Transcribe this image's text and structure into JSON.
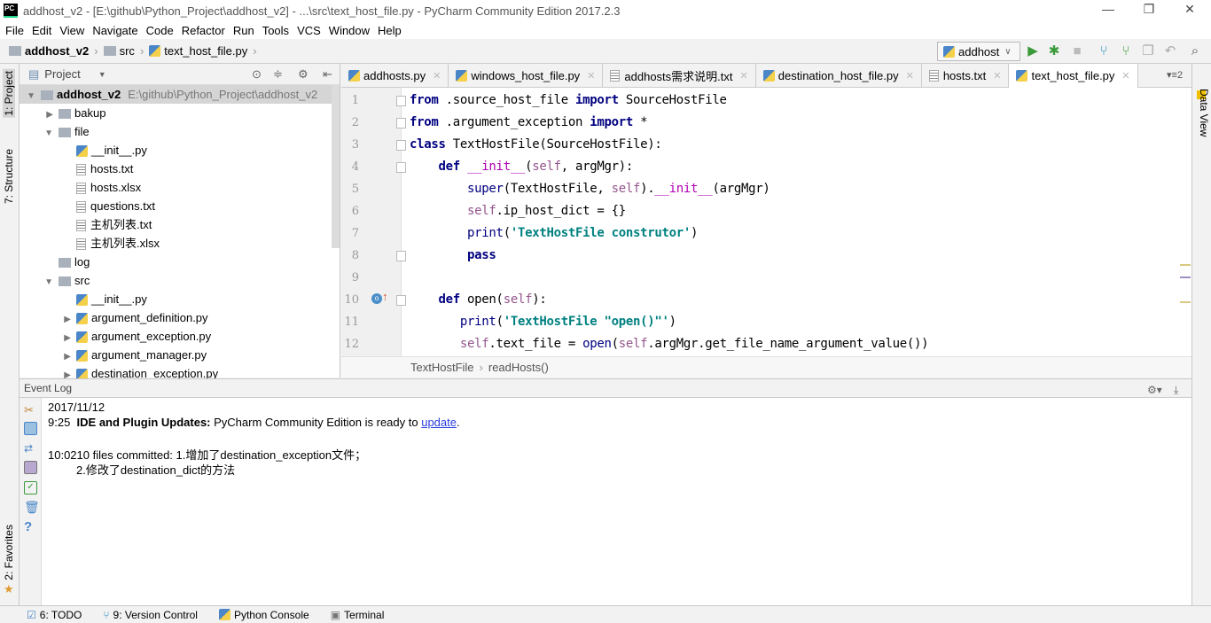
{
  "window": {
    "title": "addhost_v2 - [E:\\github\\Python_Project\\addhost_v2] - ...\\src\\text_host_file.py - PyCharm Community Edition 2017.2.3",
    "logo": "PC"
  },
  "menu": [
    "File",
    "Edit",
    "View",
    "Navigate",
    "Code",
    "Refactor",
    "Run",
    "Tools",
    "VCS",
    "Window",
    "Help"
  ],
  "breadcrumb": [
    "addhost_v2",
    "src",
    "text_host_file.py"
  ],
  "run_config": "addhost",
  "left_strip": {
    "project": "1: Project",
    "structure": "7: Structure",
    "favorites": "2: Favorites"
  },
  "right_strip": {
    "data_view": "Data View"
  },
  "project": {
    "title": "Project",
    "tree": [
      {
        "label": "addhost_v2",
        "path": "E:\\github\\Python_Project\\addhost_v2",
        "type": "folder",
        "depth": 0,
        "expanded": true,
        "selected": true
      },
      {
        "label": "bakup",
        "type": "folder",
        "depth": 1,
        "expanded": false
      },
      {
        "label": "file",
        "type": "folder",
        "depth": 1,
        "expanded": true
      },
      {
        "label": "__init__.py",
        "type": "py",
        "depth": 2
      },
      {
        "label": "hosts.txt",
        "type": "txt",
        "depth": 2
      },
      {
        "label": "hosts.xlsx",
        "type": "txt",
        "depth": 2
      },
      {
        "label": "questions.txt",
        "type": "txt",
        "depth": 2
      },
      {
        "label": "主机列表.txt",
        "type": "txt",
        "depth": 2
      },
      {
        "label": "主机列表.xlsx",
        "type": "txt",
        "depth": 2
      },
      {
        "label": "log",
        "type": "folder",
        "depth": 1,
        "leaf": true
      },
      {
        "label": "src",
        "type": "folder",
        "depth": 1,
        "expanded": true
      },
      {
        "label": "__init__.py",
        "type": "py",
        "depth": 2
      },
      {
        "label": "argument_definition.py",
        "type": "py",
        "depth": 2,
        "expandable": true
      },
      {
        "label": "argument_exception.py",
        "type": "py",
        "depth": 2,
        "expandable": true
      },
      {
        "label": "argument_manager.py",
        "type": "py",
        "depth": 2,
        "expandable": true
      },
      {
        "label": "destination_exception.py",
        "type": "py",
        "depth": 2,
        "expandable": true
      }
    ]
  },
  "tabs": [
    {
      "label": "addhosts.py",
      "type": "py"
    },
    {
      "label": "windows_host_file.py",
      "type": "py"
    },
    {
      "label": "addhosts需求说明.txt",
      "type": "txt"
    },
    {
      "label": "destination_host_file.py",
      "type": "py"
    },
    {
      "label": "hosts.txt",
      "type": "txt"
    },
    {
      "label": "text_host_file.py",
      "type": "py",
      "active": true
    }
  ],
  "tab_overflow": "2",
  "code": [
    [
      [
        "kw",
        "from"
      ],
      [
        "n",
        " .source_host_file "
      ],
      [
        "kw",
        "import"
      ],
      [
        "n",
        " SourceHostFile"
      ]
    ],
    [
      [
        "kw",
        "from"
      ],
      [
        "n",
        " .argument_exception "
      ],
      [
        "kw",
        "import"
      ],
      [
        "n",
        " *"
      ]
    ],
    [
      [
        "kw",
        "class"
      ],
      [
        "n",
        " TextHostFile(SourceHostFile):"
      ]
    ],
    [
      [
        "n",
        "    "
      ],
      [
        "kw",
        "def"
      ],
      [
        "n",
        " "
      ],
      [
        "fn",
        "__init__"
      ],
      [
        "n",
        "("
      ],
      [
        "sf",
        "self"
      ],
      [
        "n",
        ", argMgr):"
      ]
    ],
    [
      [
        "n",
        "        "
      ],
      [
        "bi",
        "super"
      ],
      [
        "n",
        "(TextHostFile, "
      ],
      [
        "sf",
        "self"
      ],
      [
        "n",
        ")."
      ],
      [
        "fn",
        "__init__"
      ],
      [
        "n",
        "(argMgr)"
      ]
    ],
    [
      [
        "n",
        "        "
      ],
      [
        "sf",
        "self"
      ],
      [
        "n",
        ".ip_host_dict = {}"
      ]
    ],
    [
      [
        "n",
        "        "
      ],
      [
        "bi",
        "print"
      ],
      [
        "n",
        "("
      ],
      [
        "st",
        "'TextHostFile construtor'"
      ],
      [
        "n",
        ")"
      ]
    ],
    [
      [
        "n",
        "        "
      ],
      [
        "kw",
        "pass"
      ]
    ],
    [],
    [
      [
        "n",
        "    "
      ],
      [
        "kw",
        "def"
      ],
      [
        "n",
        " open("
      ],
      [
        "sf",
        "self"
      ],
      [
        "n",
        "):"
      ]
    ],
    [
      [
        "n",
        "       "
      ],
      [
        "bi",
        "print"
      ],
      [
        "n",
        "("
      ],
      [
        "st",
        "'TextHostFile \"open()\"'"
      ],
      [
        "n",
        ")"
      ]
    ],
    [
      [
        "n",
        "       "
      ],
      [
        "sf",
        "self"
      ],
      [
        "n",
        ".text_file = "
      ],
      [
        "bi",
        "open"
      ],
      [
        "n",
        "("
      ],
      [
        "sf",
        "self"
      ],
      [
        "n",
        ".argMgr.get_file_name_argument_value())"
      ]
    ]
  ],
  "editor_breadcrumb": [
    "TextHostFile",
    "readHosts()"
  ],
  "event_log": {
    "title": "Event Log",
    "date": "2017/11/12",
    "entries": [
      {
        "time": "9:25",
        "bold": "IDE and Plugin Updates:",
        "text": " PyCharm Community Edition is ready to ",
        "link": "update",
        "after": "."
      },
      {
        "time": "10:02",
        "text": "10 files committed: 1.增加了destination_exception文件；",
        "line2": "2.修改了destination_dict的方法"
      }
    ]
  },
  "bottom_tabs": [
    "6: TODO",
    "9: Version Control",
    "Python Console",
    "Terminal"
  ]
}
